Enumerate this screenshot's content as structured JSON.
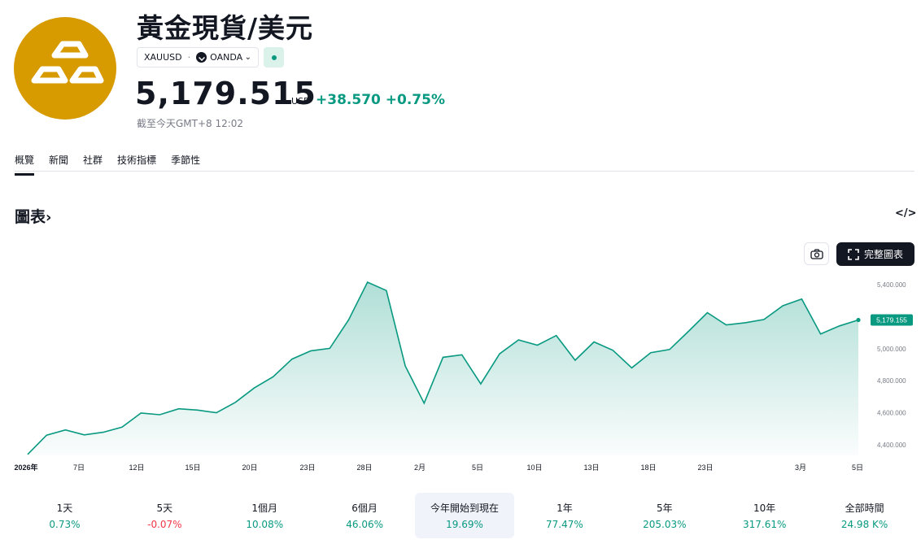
{
  "header": {
    "title": "黃金現貨/美元",
    "symbol": "XAUUSD",
    "separator": "·",
    "exchange": "OANDA",
    "price": "5,179.515",
    "currency": "USD",
    "change": "+38.570 +0.75%",
    "as_of": "截至今天GMT+8 12:02"
  },
  "tabs": [
    {
      "label": "概覽",
      "active": true
    },
    {
      "label": "新聞"
    },
    {
      "label": "社群"
    },
    {
      "label": "技術指標"
    },
    {
      "label": "季節性"
    }
  ],
  "chart_section": {
    "title": "圖表",
    "arrow": "›",
    "embed_icon": "</>",
    "fullscreen_label": "完整圖表",
    "camera_icon": "camera-icon"
  },
  "chart_data": {
    "type": "area",
    "x_tick_labels": [
      "2026年",
      "7日",
      "12日",
      "15日",
      "20日",
      "23日",
      "28日",
      "2月",
      "5日",
      "10日",
      "13日",
      "18日",
      "23日",
      "3月",
      "5日"
    ],
    "y_tick_labels": [
      "5,400.000",
      "5,000.000",
      "4,800.000",
      "4,600.000",
      "4,400.000"
    ],
    "ylim": [
      4400,
      5400
    ],
    "last_price_label": "5,179.155",
    "values": [
      4340,
      4460,
      4493,
      4462,
      4478,
      4510,
      4598,
      4588,
      4625,
      4617,
      4600,
      4665,
      4755,
      4825,
      4935,
      4987,
      5002,
      5180,
      5415,
      5363,
      4892,
      4660,
      4946,
      4962,
      4780,
      4968,
      5055,
      5022,
      5082,
      4928,
      5042,
      4990,
      4880,
      4975,
      4995,
      5108,
      5225,
      5148,
      5162,
      5182,
      5268,
      5310,
      5092,
      5142,
      5179
    ]
  },
  "colors": {
    "accent": "#089981",
    "negative": "#f23645",
    "logo": "#d79b00",
    "dark": "#131722"
  },
  "periods": [
    {
      "label": "1天",
      "value": "0.73%",
      "sign": "pos"
    },
    {
      "label": "5天",
      "value": "-0.07%",
      "sign": "neg"
    },
    {
      "label": "1個月",
      "value": "10.08%",
      "sign": "pos"
    },
    {
      "label": "6個月",
      "value": "46.06%",
      "sign": "pos"
    },
    {
      "label": "今年開始到現在",
      "value": "19.69%",
      "sign": "pos",
      "active": true
    },
    {
      "label": "1年",
      "value": "77.47%",
      "sign": "pos"
    },
    {
      "label": "5年",
      "value": "205.03%",
      "sign": "pos"
    },
    {
      "label": "10年",
      "value": "317.61%",
      "sign": "pos"
    },
    {
      "label": "全部時間",
      "value": "24.98 K%",
      "sign": "pos"
    }
  ]
}
